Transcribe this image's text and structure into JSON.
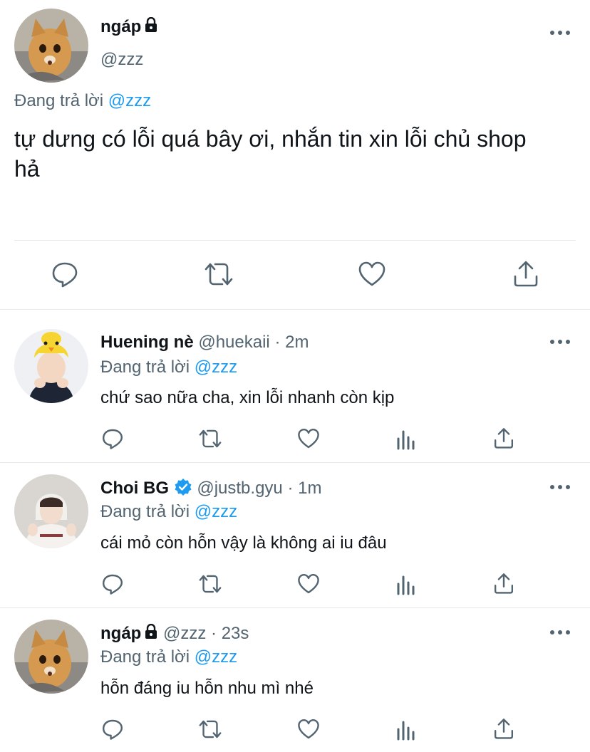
{
  "main_tweet": {
    "name": "ngáp",
    "handle": "@zzz",
    "reply_prefix": "Đang trả lời",
    "reply_to": "@zzz",
    "text_line1": "tự dưng có lỗi quá bây ơi, nhắn tin xin lỗi chủ shop",
    "text_line2": "hả"
  },
  "replies": [
    {
      "name": "Huening nè",
      "handle": "@huekaii",
      "time": "· 2m",
      "reply_prefix": "Đang trả lời",
      "reply_to": "@zzz",
      "text": "chứ sao nữa cha, xin lỗi nhanh còn kịp"
    },
    {
      "name": "Choi BG",
      "handle": "@justb.gyu",
      "time": "· 1m",
      "reply_prefix": "Đang trả lời",
      "reply_to": "@zzz",
      "text": "cái mỏ còn hỗn vậy là không ai iu đâu"
    },
    {
      "name": "ngáp",
      "handle": "@zzz",
      "time": "· 23s",
      "reply_prefix": "Đang trả lời",
      "reply_to": "@zzz",
      "text": "hỗn đáng iu hỗn nhu mì nhé"
    }
  ],
  "icons": [
    "lock-icon",
    "verified-icon",
    "more-icon",
    "reply-icon",
    "retweet-icon",
    "like-icon",
    "views-icon",
    "share-icon"
  ],
  "colors": {
    "link": "#1d9bf0",
    "secondary": "#536471",
    "verified": "#1d9bf0"
  }
}
